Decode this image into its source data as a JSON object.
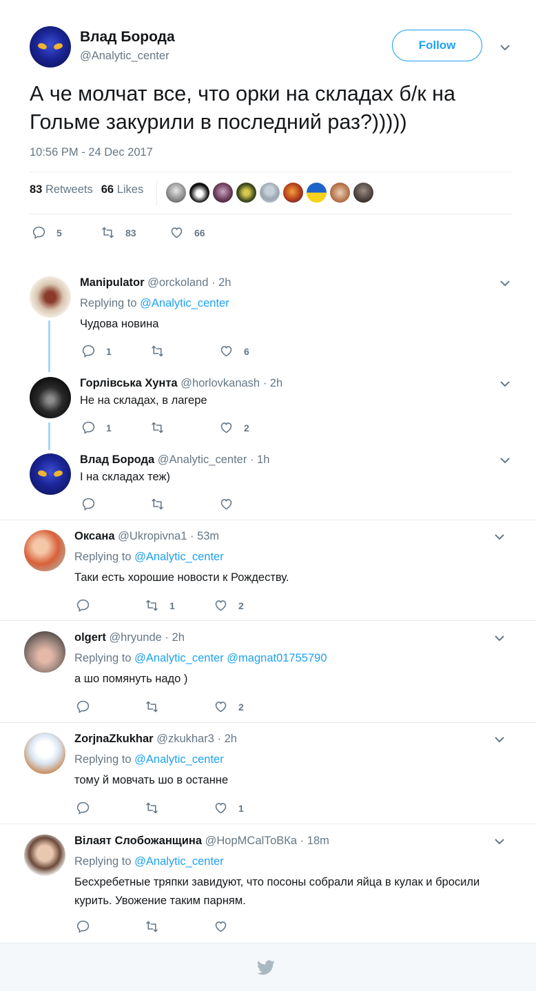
{
  "main": {
    "author_name": "Влад Борода",
    "author_handle": "@Analytic_center",
    "follow_label": "Follow",
    "text": "А че молчат все, что орки на складах б/к на Гольме закурили в последний раз?)))))",
    "timestamp": "10:56 PM - 24 Dec 2017",
    "retweets_count": "83",
    "retweets_label": "Retweets",
    "likes_count": "66",
    "likes_label": "Likes",
    "actions": {
      "reply": "5",
      "retweet": "83",
      "like": "66"
    }
  },
  "replies": [
    {
      "name": "Manipulator",
      "handle": "@orckoland",
      "time": "2h",
      "replying_prefix": "Replying to",
      "replying_to": "@Analytic_center",
      "text": "Чудова новина",
      "actions": {
        "reply": "1",
        "retweet": "",
        "like": "6"
      }
    },
    {
      "name": "Горлівська Хунта",
      "handle": "@horlovkanash",
      "time": "2h",
      "text": "Не на складах, в лагере",
      "actions": {
        "reply": "1",
        "retweet": "",
        "like": "2"
      }
    },
    {
      "name": "Влад Борода",
      "handle": "@Analytic_center",
      "time": "1h",
      "text": "І на складах теж)",
      "actions": {
        "reply": "",
        "retweet": "",
        "like": ""
      }
    },
    {
      "name": "Оксана",
      "handle": "@Ukropivna1",
      "time": "53m",
      "replying_prefix": "Replying to",
      "replying_to": "@Analytic_center",
      "text": "Таки есть хорошие новости к Рождеству.",
      "actions": {
        "reply": "",
        "retweet": "1",
        "like": "2"
      }
    },
    {
      "name": "olgert",
      "handle": "@hryunde",
      "time": "2h",
      "replying_prefix": "Replying to",
      "replying_to": "@Analytic_center @magnat01755790",
      "text": "а шо помянуть надо )",
      "actions": {
        "reply": "",
        "retweet": "",
        "like": "2"
      }
    },
    {
      "name": "ZorjnaZkukhar",
      "handle": "@zkukhar3",
      "time": "2h",
      "replying_prefix": "Replying to",
      "replying_to": "@Analytic_center",
      "text": "тому й мовчать шо в останне",
      "actions": {
        "reply": "",
        "retweet": "",
        "like": "1"
      }
    },
    {
      "name": "Вілаят Слобожанщина",
      "handle": "@НорМСаlТоВКа",
      "time": "18m",
      "replying_prefix": "Replying to",
      "replying_to": "@Analytic_center",
      "text": "Бесхребетные тряпки завидуют, что посоны собрали яйца в кулак и бросили курить. Увожение таким парням.",
      "actions": {
        "reply": "",
        "retweet": "",
        "like": ""
      }
    }
  ],
  "separator_dot": "·",
  "colors": {
    "accent": "#1da1f2",
    "muted": "#657786",
    "thread": "#a6d7f7"
  }
}
